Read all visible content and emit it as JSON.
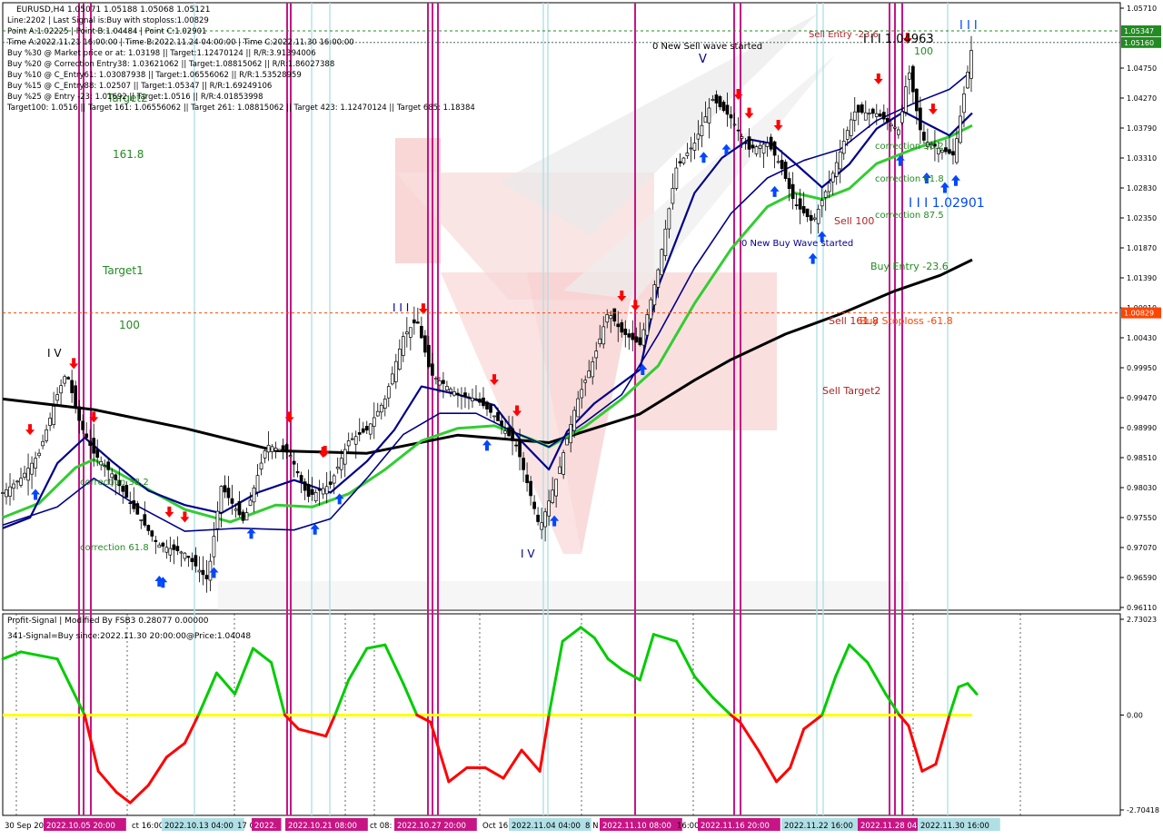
{
  "header": {
    "symbol_line": "EURUSD,H4  1.05071 1.05188 1.05068 1.05121",
    "lines": [
      "Line:2202 | Last Signal is:Buy with stoploss:1.00829",
      "Point A:1.02225 | Point B:1.04484 | Point C:1.02901",
      "Time A:2022.11.21 16:00:00 | Time B:2022.11.24 04:00:00 | Time C:2022.11.30 16:00:00",
      "Buy %30 @ Market price or at: 1.03198 || Target:1.12470124 || R/R:3.91394006",
      "Buy %20 @ Correction Entry38: 1.03621062 || Target:1.08815062 || R/R:1.86027388",
      "Buy %10 @ C_Entry61: 1.03087938 || Target:1.06556062 || R/R:1.53528959",
      "Buy %15 @ C_Entry88: 1.02507 || Target:1.05347 || R/R:1.69249106",
      "Buy %25 @ Entry -23: 1.01692 || Target:1.0516 || R/R:4.01853998",
      "Target100: 1.0516 || Target 161: 1.06556062 || Target 261: 1.08815062 || Target 423: 1.12470124 || Target 685: 1.18384"
    ]
  },
  "main_labels": {
    "l1618": "161.8",
    "target1": "Target1",
    "l100": "100",
    "target2_overlap": "Target2",
    "correction_382_left": "correction 38.2",
    "correction_61_left": "correction 61.8",
    "wave_iv_left": "I V",
    "wave_iii_mid": "I I I",
    "wave_iv_mid": "I V",
    "wave_v": "V",
    "new_sell_wave": "0 New Sell wave started",
    "new_buy_wave": "0 New Buy Wave started",
    "sell_entry": "Sell Entry -23.6",
    "wave_iii_top": "I I I 1.04963",
    "l100_top": "100",
    "correction_382_right": "correction 38.2",
    "correction_618_right": "correction 61.8",
    "correction_875_right": "correction 87.5",
    "point_c_label": "I I I 1.02901",
    "sell_100": "Sell 100",
    "buy_entry": "Buy Entry -23.6",
    "sell_1618": "Sell 161.8",
    "buy_stoploss": "Buy Stoploss -61.8",
    "sell_target2": "Sell Target2",
    "top_right_iii": "I I I"
  },
  "price_axis": {
    "ticks": [
      "1.05710",
      "1.05347",
      "1.05160",
      "1.04750",
      "1.04270",
      "1.03790",
      "1.03310",
      "1.02830",
      "1.02350",
      "1.01870",
      "1.01390",
      "1.00910",
      "1.00430",
      "0.99950",
      "0.99470",
      "0.98990",
      "0.98510",
      "0.98030",
      "0.97550",
      "0.97070",
      "0.96590",
      "0.96110"
    ],
    "badges": [
      {
        "text": "1.05347",
        "price": 1.05347,
        "bg": "#228b22"
      },
      {
        "text": "1.05160",
        "price": 1.0516,
        "bg": "#228b22"
      },
      {
        "text": "1.00829",
        "price": 1.00829,
        "bg": "#ff4500"
      }
    ]
  },
  "indicator": {
    "title": "Profit-Signal | Modified By FSB3 0.28077 0.00000",
    "signal_text": "341-Signal=Buy since:2022.11.30 20:00:00@Price:1.04048",
    "ticks": [
      "2.73023",
      "0.00",
      "-2.70418"
    ]
  },
  "time_axis": {
    "labels": [
      {
        "text": "30 Sep 2022",
        "x": 2,
        "hl": false
      },
      {
        "text": "2022.10.05 20:00",
        "x": 48,
        "hl": true,
        "bg": "#c71585"
      },
      {
        "text": "ct 16:00",
        "x": 142,
        "hl": false
      },
      {
        "text": "2022.10.13 04:00",
        "x": 178,
        "hl": true,
        "bg": "#b0e0e6"
      },
      {
        "text": "17 O",
        "x": 258,
        "hl": false
      },
      {
        "text": "2022.",
        "x": 277,
        "hl": true,
        "bg": "#c71585"
      },
      {
        "text": "2022.10.21 08:00",
        "x": 314,
        "hl": true,
        "bg": "#c71585"
      },
      {
        "text": "ct 08:",
        "x": 404,
        "hl": false
      },
      {
        "text": "2022.10.27 20:00",
        "x": 434,
        "hl": true,
        "bg": "#c71585"
      },
      {
        "text": "Oct 16:",
        "x": 528,
        "hl": false
      },
      {
        "text": "2022.11.04 04:00",
        "x": 560,
        "hl": true,
        "bg": "#b0e0e6"
      },
      {
        "text": "8 N",
        "x": 641,
        "hl": false
      },
      {
        "text": "2022.11.10 08:00",
        "x": 660,
        "hl": true,
        "bg": "#c71585"
      },
      {
        "text": "16:00",
        "x": 742,
        "hl": false
      },
      {
        "text": "2022.11.16 20:00",
        "x": 768,
        "hl": true,
        "bg": "#c71585"
      },
      {
        "text": "2022.11.22 16:00",
        "x": 860,
        "hl": true,
        "bg": "#b0e0e6"
      },
      {
        "text": "2022.11.28 04",
        "x": 944,
        "hl": true,
        "bg": "#c71585"
      },
      {
        "text": "2022.11.30 16:00",
        "x": 1010,
        "hl": true,
        "bg": "#b0e0e6"
      }
    ]
  },
  "colors": {
    "bull_line": "#00cc00",
    "bear_line": "#ff0000",
    "zero_line": "#ffff00",
    "ma_black": "#000000",
    "ma_navy": "#00008b",
    "ma_green": "#32cd32",
    "magenta": "#c71585",
    "cyan": "#b0e0e6"
  },
  "chart_data": [
    {
      "type": "candlestick",
      "title": "EURUSD,H4",
      "ylim": [
        0.9611,
        1.0571
      ],
      "x_index_range": [
        0,
        1065
      ],
      "ma_long_black": [
        [
          0,
          0.9945
        ],
        [
          100,
          0.9928
        ],
        [
          200,
          0.9898
        ],
        [
          300,
          0.9862
        ],
        [
          400,
          0.9858
        ],
        [
          500,
          0.9887
        ],
        [
          600,
          0.9875
        ],
        [
          700,
          0.9921
        ],
        [
          760,
          0.9975
        ],
        [
          800,
          1.0008
        ],
        [
          860,
          1.0049
        ],
        [
          920,
          1.0081
        ],
        [
          980,
          1.0118
        ],
        [
          1030,
          1.0143
        ],
        [
          1065,
          1.0168
        ]
      ],
      "ma_navy_fast": [
        [
          0,
          0.9738
        ],
        [
          30,
          0.9755
        ],
        [
          60,
          0.9842
        ],
        [
          90,
          0.9883
        ],
        [
          120,
          0.9845
        ],
        [
          160,
          0.9798
        ],
        [
          200,
          0.9775
        ],
        [
          240,
          0.9762
        ],
        [
          280,
          0.9795
        ],
        [
          320,
          0.9815
        ],
        [
          360,
          0.9795
        ],
        [
          400,
          0.9845
        ],
        [
          430,
          0.9895
        ],
        [
          460,
          0.9965
        ],
        [
          500,
          0.9952
        ],
        [
          540,
          0.9935
        ],
        [
          570,
          0.9877
        ],
        [
          600,
          0.9832
        ],
        [
          620,
          0.9893
        ],
        [
          650,
          0.9938
        ],
        [
          700,
          0.9992
        ],
        [
          720,
          1.0125
        ],
        [
          760,
          1.0275
        ],
        [
          790,
          1.0331
        ],
        [
          820,
          1.0361
        ],
        [
          845,
          1.0354
        ],
        [
          870,
          1.0323
        ],
        [
          900,
          1.0284
        ],
        [
          930,
          1.0321
        ],
        [
          960,
          1.0378
        ],
        [
          990,
          1.0405
        ],
        [
          1020,
          1.0382
        ],
        [
          1040,
          1.0367
        ],
        [
          1065,
          1.0403
        ]
      ],
      "ma_navy_slow": [
        [
          0,
          0.9743
        ],
        [
          60,
          0.9772
        ],
        [
          100,
          0.9818
        ],
        [
          150,
          0.9772
        ],
        [
          200,
          0.9733
        ],
        [
          260,
          0.9738
        ],
        [
          320,
          0.9735
        ],
        [
          360,
          0.9753
        ],
        [
          400,
          0.9818
        ],
        [
          440,
          0.9888
        ],
        [
          480,
          0.9922
        ],
        [
          520,
          0.9922
        ],
        [
          560,
          0.9893
        ],
        [
          600,
          0.9868
        ],
        [
          640,
          0.9908
        ],
        [
          680,
          0.9952
        ],
        [
          720,
          1.0048
        ],
        [
          760,
          1.0155
        ],
        [
          800,
          1.0242
        ],
        [
          840,
          1.0299
        ],
        [
          880,
          1.0327
        ],
        [
          920,
          1.0345
        ],
        [
          960,
          1.0391
        ],
        [
          1000,
          1.0418
        ],
        [
          1040,
          1.0441
        ],
        [
          1065,
          1.0471
        ]
      ],
      "ma_green": [
        [
          0,
          0.9755
        ],
        [
          40,
          0.9778
        ],
        [
          80,
          0.9835
        ],
        [
          100,
          0.9848
        ],
        [
          150,
          0.9808
        ],
        [
          200,
          0.9768
        ],
        [
          250,
          0.9748
        ],
        [
          300,
          0.9775
        ],
        [
          340,
          0.9772
        ],
        [
          380,
          0.9793
        ],
        [
          420,
          0.9832
        ],
        [
          460,
          0.9878
        ],
        [
          500,
          0.9898
        ],
        [
          540,
          0.9902
        ],
        [
          580,
          0.9881
        ],
        [
          600,
          0.9868
        ],
        [
          640,
          0.9901
        ],
        [
          680,
          0.9945
        ],
        [
          720,
          0.9998
        ],
        [
          760,
          1.0098
        ],
        [
          800,
          1.0185
        ],
        [
          840,
          1.0253
        ],
        [
          870,
          1.0275
        ],
        [
          900,
          1.0265
        ],
        [
          930,
          1.0282
        ],
        [
          960,
          1.0322
        ],
        [
          1000,
          1.0345
        ],
        [
          1040,
          1.0365
        ],
        [
          1065,
          1.0383
        ]
      ],
      "close_path": [
        [
          0,
          0.9795
        ],
        [
          20,
          0.9818
        ],
        [
          40,
          0.9858
        ],
        [
          60,
          0.9952
        ],
        [
          70,
          0.9988
        ],
        [
          85,
          0.9905
        ],
        [
          100,
          0.9858
        ],
        [
          120,
          0.9825
        ],
        [
          140,
          0.9778
        ],
        [
          170,
          0.9712
        ],
        [
          200,
          0.9698
        ],
        [
          225,
          0.9655
        ],
        [
          240,
          0.9805
        ],
        [
          265,
          0.9748
        ],
        [
          290,
          0.9872
        ],
        [
          315,
          0.9858
        ],
        [
          335,
          0.9788
        ],
        [
          360,
          0.9808
        ],
        [
          380,
          0.9878
        ],
        [
          400,
          0.9895
        ],
        [
          420,
          0.9945
        ],
        [
          440,
          1.0045
        ],
        [
          455,
          1.0072
        ],
        [
          470,
          0.9985
        ],
        [
          500,
          0.9952
        ],
        [
          520,
          0.9945
        ],
        [
          540,
          0.9918
        ],
        [
          565,
          0.9868
        ],
        [
          590,
          0.9738
        ],
        [
          610,
          0.9825
        ],
        [
          630,
          0.9938
        ],
        [
          650,
          1.0012
        ],
        [
          665,
          1.0085
        ],
        [
          680,
          1.0052
        ],
        [
          700,
          1.0032
        ],
        [
          720,
          1.0152
        ],
        [
          740,
          1.0315
        ],
        [
          760,
          1.0355
        ],
        [
          780,
          1.0425
        ],
        [
          800,
          1.0395
        ],
        [
          820,
          1.0345
        ],
        [
          840,
          1.0355
        ],
        [
          855,
          1.0318
        ],
        [
          870,
          1.0258
        ],
        [
          890,
          1.0228
        ],
        [
          910,
          1.0298
        ],
        [
          935,
          1.0405
        ],
        [
          960,
          1.0402
        ],
        [
          985,
          1.0375
        ],
        [
          995,
          1.0475
        ],
        [
          1010,
          1.0361
        ],
        [
          1030,
          1.0345
        ],
        [
          1045,
          1.0335
        ],
        [
          1055,
          1.0425
        ],
        [
          1065,
          1.0512
        ]
      ],
      "signal_arrows": {
        "sell_x": [
          30,
          78,
          100,
          183,
          200,
          315,
          352,
          354,
          462,
          540,
          565,
          680,
          695,
          808,
          820,
          852,
          962,
          994,
          1022
        ],
        "buy_x": [
          36,
          172,
          176,
          232,
          273,
          343,
          370,
          532,
          606,
          703,
          770,
          795,
          848,
          890,
          900,
          986,
          1015,
          1035,
          1047
        ]
      },
      "levels": [
        {
          "name": "Buy Stoploss -61.8",
          "price": 1.00829
        },
        {
          "name": "Target100",
          "price": 1.0516
        },
        {
          "name": "Target161",
          "price": 1.06556062
        },
        {
          "name": "Sell Entry -23.6",
          "price": 1.05347
        }
      ]
    },
    {
      "type": "line",
      "title": "Profit-Signal | Modified By FSB3 0.28077 0.00000",
      "ylim": [
        -2.70418,
        2.73023
      ],
      "x": [
        0,
        20,
        40,
        60,
        75,
        90,
        105,
        125,
        140,
        160,
        180,
        200,
        215,
        235,
        255,
        275,
        295,
        310,
        325,
        340,
        355,
        365,
        380,
        400,
        420,
        440,
        455,
        470,
        490,
        510,
        530,
        550,
        570,
        590,
        600,
        615,
        635,
        650,
        665,
        680,
        700,
        715,
        740,
        760,
        780,
        800,
        810,
        830,
        850,
        865,
        880,
        900,
        915,
        930,
        950,
        970,
        985,
        995,
        1010,
        1025,
        1040,
        1050,
        1060,
        1070
      ],
      "values": [
        1.6,
        1.8,
        1.7,
        1.6,
        0.8,
        0.0,
        -1.6,
        -2.2,
        -2.5,
        -2.0,
        -1.2,
        -0.8,
        0.0,
        1.2,
        0.6,
        1.9,
        1.5,
        0.0,
        -0.4,
        -0.5,
        -0.6,
        0.0,
        1.0,
        1.9,
        2.0,
        0.9,
        0.0,
        -0.2,
        -1.9,
        -1.5,
        -1.5,
        -1.8,
        -1.0,
        -1.6,
        0.0,
        2.1,
        2.5,
        2.2,
        1.6,
        1.3,
        1.0,
        2.3,
        2.1,
        1.1,
        0.5,
        0.0,
        -0.2,
        -1.0,
        -1.9,
        -1.5,
        -0.4,
        0.0,
        1.1,
        2.0,
        1.5,
        0.6,
        0.0,
        -0.3,
        -1.6,
        -1.4,
        0.0,
        0.8,
        0.9,
        0.6
      ],
      "zero_level": 0
    }
  ]
}
